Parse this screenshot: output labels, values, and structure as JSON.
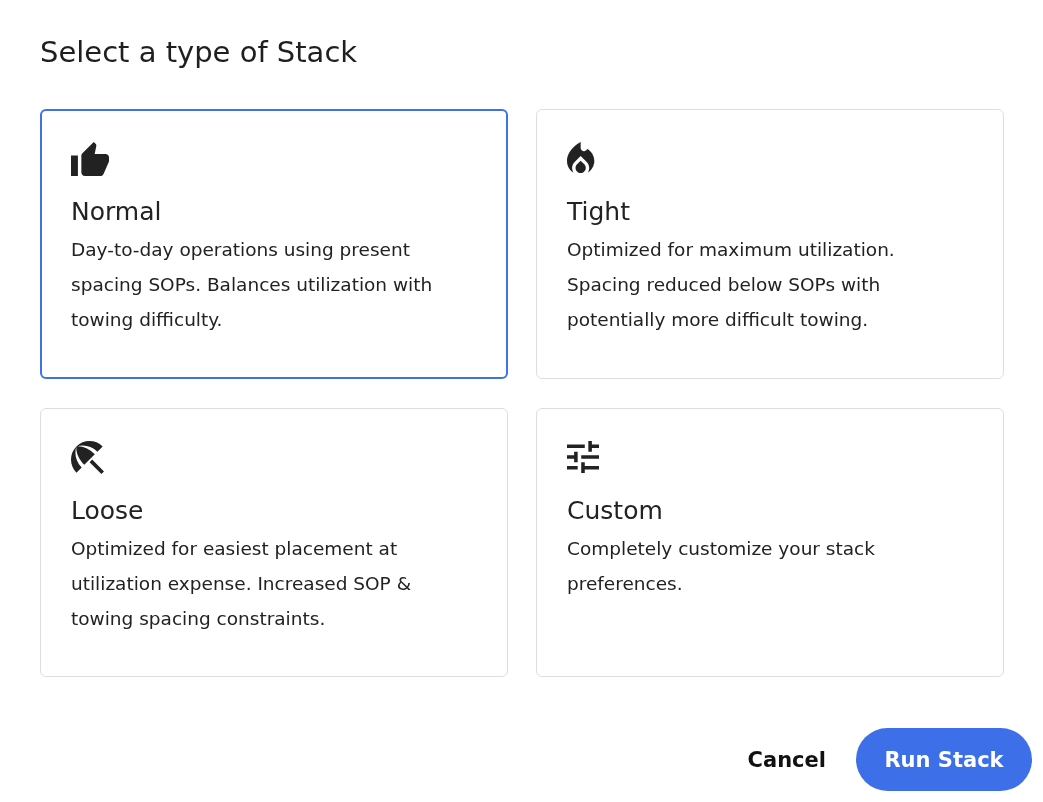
{
  "dialog": {
    "title": "Select a type of Stack",
    "options": [
      {
        "kind": "thumbs-up",
        "title": "Normal",
        "description": "Day-to-day operations using present spacing SOPs. Balances utilization with towing difficulty.",
        "selected": true
      },
      {
        "kind": "flame",
        "title": "Tight",
        "description": "Optimized for maximum utilization. Spacing reduced below SOPs with potentially more difficult towing.",
        "selected": false
      },
      {
        "kind": "umbrella",
        "title": "Loose",
        "description": "Optimized for easiest placement at utilization expense. Increased SOP & towing spacing constraints.",
        "selected": false
      },
      {
        "kind": "sliders",
        "title": "Custom",
        "description": "Completely customize your stack preferences.",
        "selected": false
      }
    ],
    "buttons": [
      {
        "kind": "text",
        "label": "Cancel"
      },
      {
        "kind": "primary",
        "label": "Run Stack"
      }
    ]
  }
}
